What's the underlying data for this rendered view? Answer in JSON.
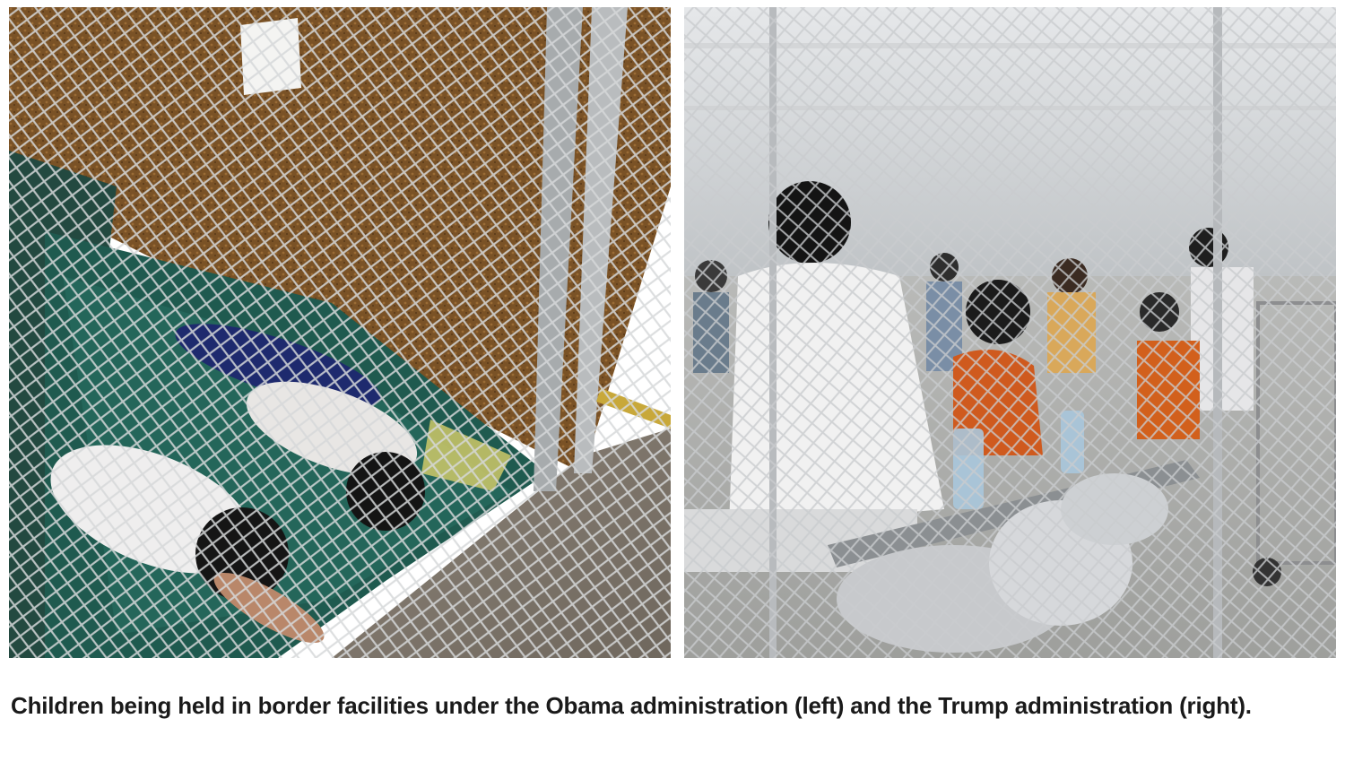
{
  "article": {
    "caption": "Children being held in border facilities under the Obama administration (left) and the Trump administration (right)."
  },
  "photos": {
    "left": {
      "description_icon": "photo-obama-era-facility"
    },
    "right": {
      "description_icon": "photo-trump-era-facility"
    }
  },
  "colors": {
    "caption_text": "#1a1a1a",
    "background": "#ffffff",
    "fence": "#c9ccce",
    "mat_green": "#1f5a4f",
    "foil": "#c7c9cc"
  }
}
